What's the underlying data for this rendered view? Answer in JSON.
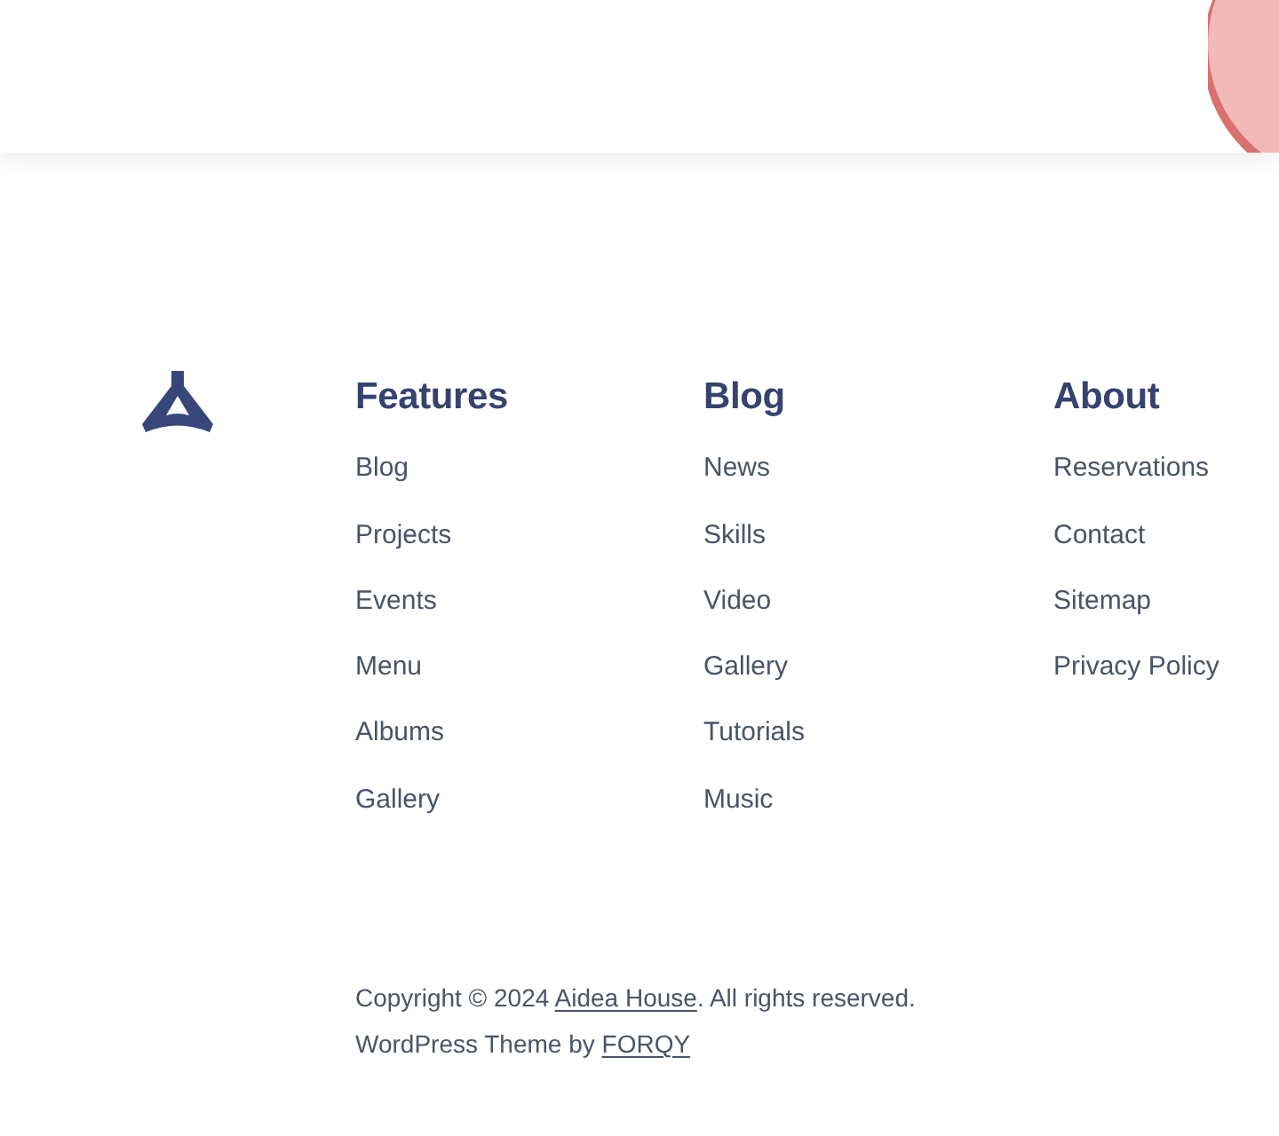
{
  "footer": {
    "columns": [
      {
        "heading": "Features",
        "links": [
          "Blog",
          "Projects",
          "Events",
          "Menu",
          "Albums",
          "Gallery"
        ]
      },
      {
        "heading": "Blog",
        "links": [
          "News",
          "Skills",
          "Video",
          "Gallery",
          "Tutorials",
          "Music"
        ]
      },
      {
        "heading": "About",
        "links": [
          "Reservations",
          "Contact",
          "Sitemap",
          "Privacy Policy"
        ]
      }
    ],
    "copyright": {
      "before": "Copyright © 2024 ",
      "link": "Aidea House",
      "after": ". All rights reserved."
    },
    "credit": {
      "before": "WordPress Theme by ",
      "link": "FORQY"
    }
  }
}
